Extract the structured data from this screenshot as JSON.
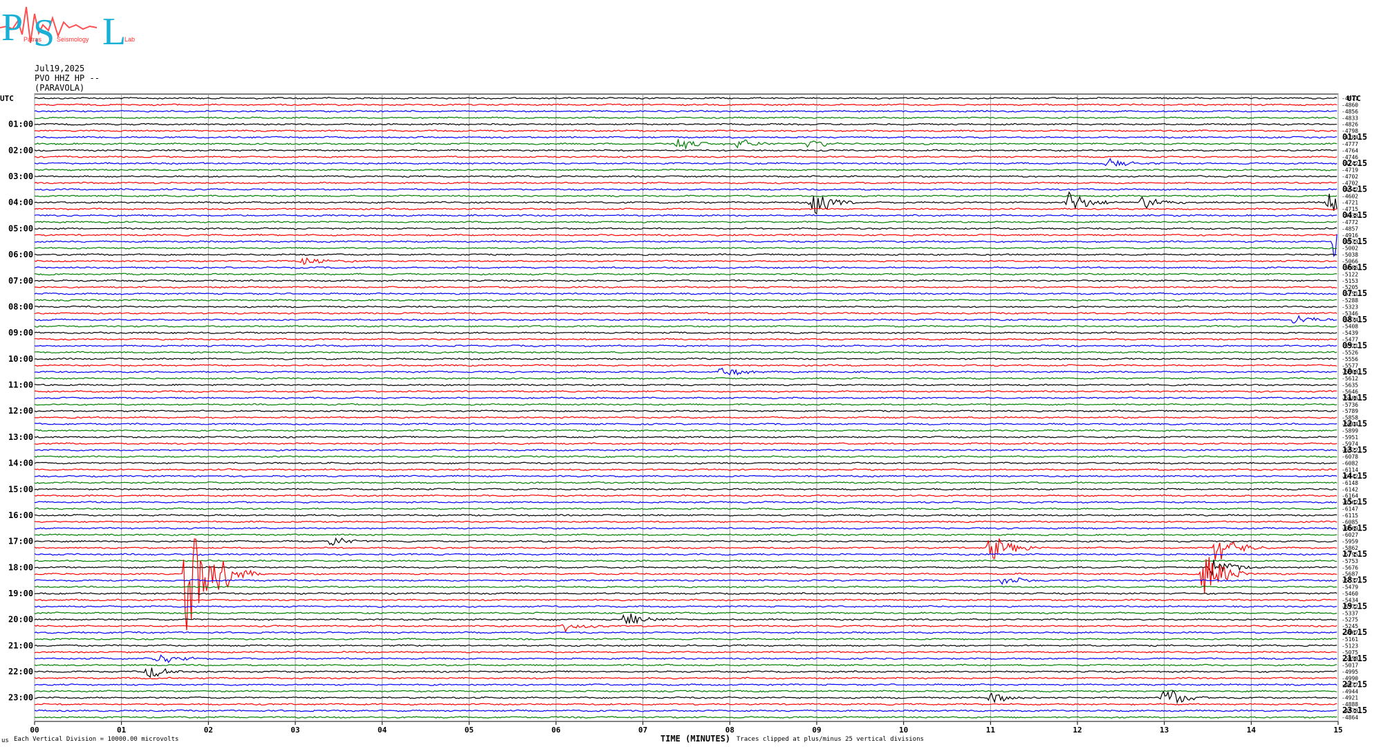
{
  "header": {
    "date": "Jul19,2025",
    "station": "PVO HHZ HP --",
    "location": "(PARAVOLA)"
  },
  "logo": {
    "letters": [
      "P",
      "S",
      "L"
    ],
    "words": [
      "Patras",
      "Seismology",
      "Lab"
    ]
  },
  "footer": {
    "corner": "us",
    "scale_note": "Each Vertical Division = 10000.00 microvolts",
    "clip_note": "Traces clipped at plus/minus 25 vertical divisions"
  },
  "chart_data": {
    "type": "line",
    "title": "",
    "xlabel": "TIME (MINUTES)",
    "ylabel_left": "UTC",
    "ylabel_right": "UTC",
    "xlim": [
      0,
      15
    ],
    "x_ticks": [
      "00",
      "01",
      "02",
      "03",
      "04",
      "05",
      "06",
      "07",
      "08",
      "09",
      "10",
      "11",
      "12",
      "13",
      "14",
      "15"
    ],
    "row_count": 96,
    "minutes_per_row": 15,
    "trace_colors": [
      "#000000",
      "#ff0000",
      "#0000ff",
      "#008000"
    ],
    "left_labels": [
      "01:00",
      "02:00",
      "03:00",
      "04:00",
      "05:00",
      "06:00",
      "07:00",
      "08:00",
      "09:00",
      "10:00",
      "11:00",
      "12:00",
      "13:00",
      "14:00",
      "15:00",
      "16:00",
      "17:00",
      "18:00",
      "19:00",
      "20:00",
      "21:00",
      "22:00",
      "23:00"
    ],
    "right_labels": [
      "01:15",
      "02:15",
      "03:15",
      "04:15",
      "05:15",
      "06:15",
      "07:15",
      "08:15",
      "09:15",
      "10:15",
      "11:15",
      "12:15",
      "13:15",
      "14:15",
      "15:15",
      "16:15",
      "17:15",
      "18:15",
      "19:15",
      "20:15",
      "21:15",
      "22:15",
      "23:15"
    ],
    "offsets": [
      -4871,
      -4860,
      -4856,
      -4833,
      -4826,
      -4798,
      -4784,
      -4777,
      -4764,
      -4746,
      -4742,
      -4719,
      -4702,
      -4702,
      -4642,
      -4602,
      -4721,
      -4715,
      -4738,
      -4772,
      -4857,
      -4916,
      -4973,
      -5002,
      -5038,
      -5066,
      -5086,
      -5122,
      -5153,
      -5205,
      -5251,
      -5288,
      -5323,
      -5346,
      -5374,
      -5408,
      -5439,
      -5477,
      -5521,
      -5526,
      -5556,
      -5577,
      -5608,
      -5612,
      -5635,
      -5646,
      -5686,
      -5736,
      -5789,
      -5858,
      -5904,
      -5899,
      -5951,
      -5974,
      -6022,
      -6078,
      -6082,
      -6114,
      -6142,
      -6148,
      -6142,
      -6164,
      -6162,
      -6147,
      -6115,
      -6085,
      -6069,
      -6027,
      -5959,
      -5862,
      -5795,
      -5753,
      -5676,
      -5687,
      -5537,
      -5479,
      -5460,
      -5434,
      -5372,
      -5337,
      -5275,
      -5245,
      -5167,
      -5161,
      -5123,
      -5075,
      -5058,
      -5017,
      -4995,
      -4990,
      -4977,
      -4944,
      -4921,
      -4888,
      -4878,
      -4864
    ],
    "events": [
      {
        "row": 7,
        "minute": 7.4,
        "amp": 2.2
      },
      {
        "row": 7,
        "minute": 8.1,
        "amp": 2.0
      },
      {
        "row": 7,
        "minute": 8.9,
        "amp": 1.8
      },
      {
        "row": 10,
        "minute": 12.35,
        "amp": 2.0
      },
      {
        "row": 16,
        "minute": 8.95,
        "amp": 5
      },
      {
        "row": 16,
        "minute": 11.9,
        "amp": 4
      },
      {
        "row": 16,
        "minute": 14.9,
        "amp": 4
      },
      {
        "row": 16,
        "minute": 12.75,
        "amp": 2.5
      },
      {
        "row": 22,
        "minute": 14.95,
        "amp": 6
      },
      {
        "row": 25,
        "minute": 3.1,
        "amp": 2
      },
      {
        "row": 34,
        "minute": 14.5,
        "amp": 2
      },
      {
        "row": 42,
        "minute": 7.9,
        "amp": 2
      },
      {
        "row": 68,
        "minute": 3.4,
        "amp": 2
      },
      {
        "row": 69,
        "minute": 11.0,
        "amp": 5
      },
      {
        "row": 69,
        "minute": 13.6,
        "amp": 6
      },
      {
        "row": 72,
        "minute": 13.55,
        "amp": 4
      },
      {
        "row": 73,
        "minute": 1.75,
        "amp": 22
      },
      {
        "row": 73,
        "minute": 2.05,
        "amp": 8
      },
      {
        "row": 73,
        "minute": 13.45,
        "amp": 9
      },
      {
        "row": 74,
        "minute": 11.15,
        "amp": 2
      },
      {
        "row": 80,
        "minute": 6.8,
        "amp": 2.5
      },
      {
        "row": 81,
        "minute": 6.1,
        "amp": 2
      },
      {
        "row": 86,
        "minute": 1.4,
        "amp": 2.5
      },
      {
        "row": 88,
        "minute": 1.3,
        "amp": 2.5
      },
      {
        "row": 92,
        "minute": 13.0,
        "amp": 4
      },
      {
        "row": 92,
        "minute": 11.0,
        "amp": 2
      }
    ]
  }
}
